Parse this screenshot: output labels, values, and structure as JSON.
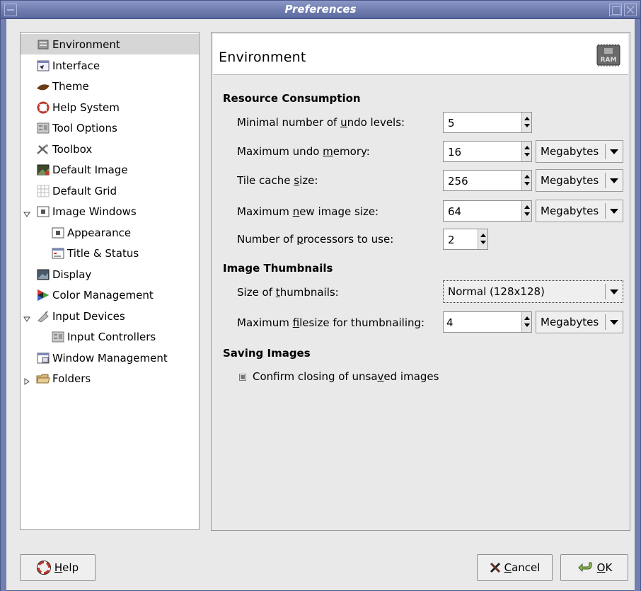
{
  "window": {
    "title": "Preferences"
  },
  "sidebar": {
    "items": [
      {
        "label": "Environment",
        "icon": "environment-icon"
      },
      {
        "label": "Interface",
        "icon": "interface-icon"
      },
      {
        "label": "Theme",
        "icon": "theme-icon"
      },
      {
        "label": "Help System",
        "icon": "help-system-icon"
      },
      {
        "label": "Tool Options",
        "icon": "tool-options-icon"
      },
      {
        "label": "Toolbox",
        "icon": "toolbox-icon"
      },
      {
        "label": "Default Image",
        "icon": "default-image-icon"
      },
      {
        "label": "Default Grid",
        "icon": "default-grid-icon"
      },
      {
        "label": "Image Windows",
        "icon": "image-windows-icon",
        "expanded": true
      },
      {
        "label": "Appearance",
        "icon": "appearance-icon"
      },
      {
        "label": "Title & Status",
        "icon": "title-status-icon"
      },
      {
        "label": "Display",
        "icon": "display-icon"
      },
      {
        "label": "Color Management",
        "icon": "color-management-icon"
      },
      {
        "label": "Input Devices",
        "icon": "input-devices-icon",
        "expanded": true
      },
      {
        "label": "Input Controllers",
        "icon": "input-controllers-icon"
      },
      {
        "label": "Window Management",
        "icon": "window-management-icon"
      },
      {
        "label": "Folders",
        "icon": "folders-icon",
        "expanded": false
      }
    ]
  },
  "panel": {
    "title": "Environment",
    "icon": "ram-icon",
    "resource": {
      "heading": "Resource Consumption",
      "undo_levels": {
        "pre": "Minimal number of ",
        "mn": "u",
        "post": "ndo levels:",
        "value": "5"
      },
      "undo_memory": {
        "pre": "Maximum undo ",
        "mn": "m",
        "post": "emory:",
        "value": "16",
        "unit": "Megabytes"
      },
      "tile_cache": {
        "pre": "Tile cache ",
        "mn": "s",
        "post": "ize:",
        "value": "256",
        "unit": "Megabytes"
      },
      "new_image": {
        "pre": "Maximum ",
        "mn": "n",
        "post": "ew image size:",
        "value": "64",
        "unit": "Megabytes"
      },
      "processors": {
        "pre": "Number of ",
        "mn": "p",
        "post": "rocessors to use:",
        "value": "2"
      }
    },
    "thumbnails": {
      "heading": "Image Thumbnails",
      "size": {
        "pre": "Size of ",
        "mn": "t",
        "post": "humbnails:",
        "value": "Normal (128x128)"
      },
      "filesize": {
        "pre": "Maximum ",
        "mn": "f",
        "post": "ilesize for thumbnailing:",
        "value": "4",
        "unit": "Megabytes"
      }
    },
    "saving": {
      "heading": "Saving Images",
      "confirm": {
        "pre": "Confirm closing of unsa",
        "mn": "v",
        "post": "ed images",
        "checked": true
      }
    }
  },
  "buttons": {
    "help": {
      "mn": "H",
      "rest": "elp"
    },
    "cancel": {
      "mn": "C",
      "rest": "ancel"
    },
    "ok": {
      "mn": "O",
      "rest": "K"
    }
  }
}
